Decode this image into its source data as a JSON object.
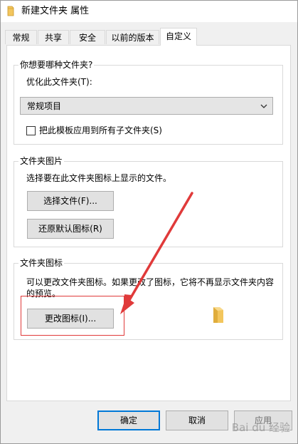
{
  "window": {
    "title": "新建文件夹 属性"
  },
  "tabs": [
    {
      "label": "常规",
      "active": false
    },
    {
      "label": "共享",
      "active": false
    },
    {
      "label": "安全",
      "active": false
    },
    {
      "label": "以前的版本",
      "active": false
    },
    {
      "label": "自定义",
      "active": true
    }
  ],
  "optimize_group": {
    "title": "你想要哪种文件夹?",
    "optimize_label": "优化此文件夹(T):",
    "selected_option": "常规项目",
    "apply_subfolders_label": "把此模板应用到所有子文件夹(S)",
    "apply_subfolders_checked": false
  },
  "picture_group": {
    "title": "文件夹图片",
    "description": "选择要在此文件夹图标上显示的文件。",
    "choose_file_button": "选择文件(F)...",
    "restore_default_button": "还原默认图标(R)"
  },
  "icon_group": {
    "title": "文件夹图标",
    "description_line1": "可以更改文件夹图标。如果更改了图标，它将不再显示文件夹内容",
    "description_line2": "的预览。",
    "change_icon_button": "更改图标(I)..."
  },
  "footer": {
    "ok_button": "确定",
    "cancel_button": "取消",
    "apply_button": "应用"
  },
  "watermark": "Bai du 经验",
  "colors": {
    "annotation_red": "#e03a3a",
    "folder_yellow": "#f3c65d",
    "accent_blue": "#0078d7"
  },
  "icons": {
    "title_icon": "folder-icon",
    "preview_icon": "folder-icon",
    "combo_arrow": "chevron-down-icon"
  }
}
